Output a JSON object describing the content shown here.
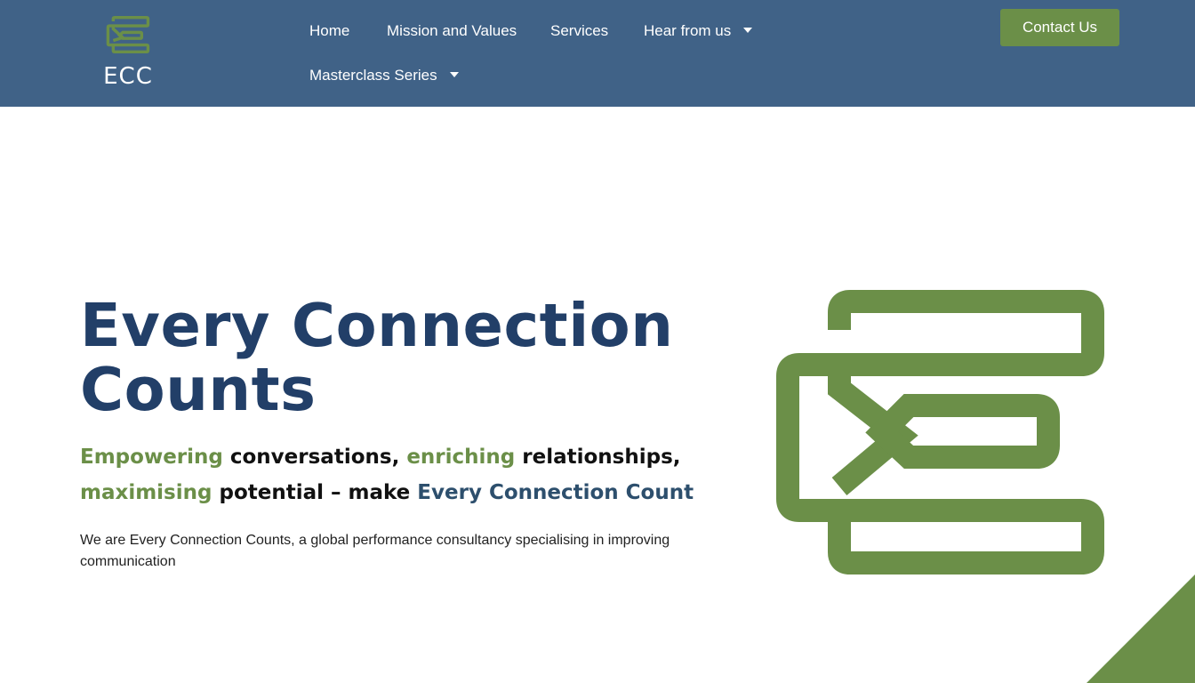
{
  "header": {
    "logo_text": "ECC",
    "nav": [
      {
        "label": "Home"
      },
      {
        "label": "Mission and Values"
      },
      {
        "label": "Services"
      },
      {
        "label": "Hear from us"
      },
      {
        "label": "Masterclass Series"
      }
    ],
    "contact_label": "Contact Us"
  },
  "hero": {
    "title_line1": "Every Connection",
    "title_line2": "Counts",
    "tagline": {
      "w1": "Empowering",
      "w2": "conversations,",
      "w3": "enriching",
      "w4": "relationships,",
      "w5": "maximising",
      "w6": "potential – make",
      "w7": "Every Connection Count"
    },
    "description": "We are Every Connection Counts, a global performance consultancy specialising in improving communication"
  },
  "colors": {
    "header_bg": "#406287",
    "brand_green": "#6b8f48",
    "title_blue": "#223f68"
  },
  "icons": {
    "nav_dropdown": "caret-down-icon",
    "logo_mark": "ecc-logo-icon"
  }
}
